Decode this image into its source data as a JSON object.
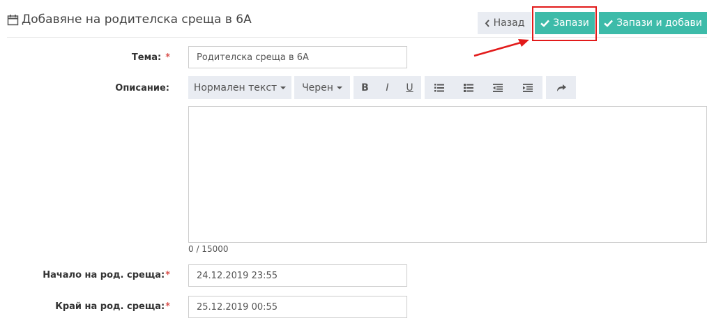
{
  "page": {
    "title": "Добавяне на родителска среща в 6А"
  },
  "actions": {
    "back_label": "Назад",
    "save_label": "Запази",
    "save_add_label": "Запази и добави"
  },
  "form": {
    "topic": {
      "label": "Тема:",
      "required": "*",
      "value": "Родителска среща в 6А"
    },
    "description": {
      "label": "Описание:",
      "toolbar": {
        "text_style": "Нормален текст",
        "color": "Черен",
        "bold": "B",
        "italic": "I",
        "underline": "U"
      },
      "counter": "0 / 15000"
    },
    "start": {
      "label": "Начало на род. среща:",
      "required": "*",
      "value": "24.12.2019 23:55"
    },
    "end": {
      "label": "Край на род. среща:",
      "required": "*",
      "value": "25.12.2019 00:55"
    }
  },
  "colors": {
    "primary": "#3dbba9",
    "secondary": "#e9ecf2",
    "required": "#d9534f",
    "annotation": "#e21a1a"
  },
  "icons": [
    "calendar-icon",
    "chevron-left-icon",
    "check-icon",
    "caret-down-icon",
    "ordered-list-icon",
    "unordered-list-icon",
    "outdent-icon",
    "indent-icon",
    "redo-icon"
  ]
}
